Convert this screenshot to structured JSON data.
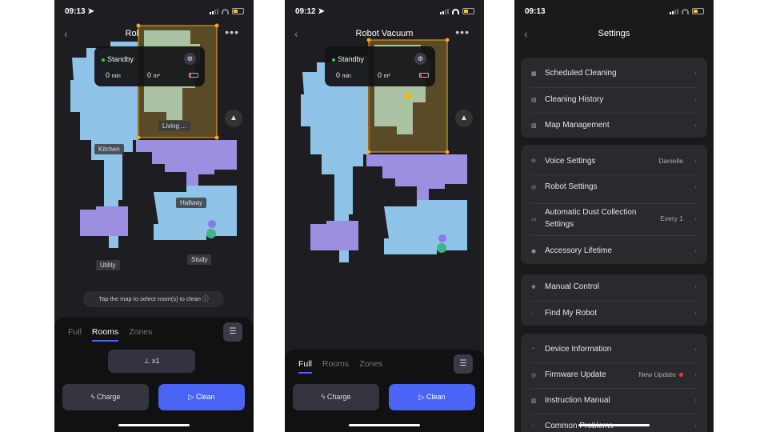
{
  "screens": [
    {
      "time": "09:13",
      "title": "Robot Vacuum",
      "status": "Standby",
      "duration": "0",
      "duration_unit": "min",
      "area": "0",
      "area_unit": "m²",
      "rooms": [
        "Living ...",
        "Kitchen",
        "Hallway",
        "Utility",
        "Study"
      ],
      "hint": "Tap the map to select room(s) to clean",
      "tabs": [
        "Full",
        "Rooms",
        "Zones"
      ],
      "active_tab": "Rooms",
      "mop_passes": "x1",
      "charge": "Charge",
      "clean": "Clean"
    },
    {
      "time": "09:12",
      "title": "Robot Vacuum",
      "status": "Standby",
      "duration": "0",
      "duration_unit": "min",
      "area": "0",
      "area_unit": "m²",
      "tabs": [
        "Full",
        "Rooms",
        "Zones"
      ],
      "active_tab": "Full",
      "charge": "Charge",
      "clean": "Clean"
    },
    {
      "time": "09:13",
      "title": "Settings",
      "groups": [
        [
          {
            "icon": "calendar-icon",
            "label": "Scheduled Cleaning"
          },
          {
            "icon": "history-icon",
            "label": "Cleaning History"
          },
          {
            "icon": "map-icon",
            "label": "Map Management"
          }
        ],
        [
          {
            "icon": "voice-icon",
            "label": "Voice Settings",
            "value": "Danielle"
          },
          {
            "icon": "robot-icon",
            "label": "Robot Settings"
          },
          {
            "icon": "dust-icon",
            "label": "Automatic Dust Collection Settings",
            "value": "Every 1"
          },
          {
            "icon": "accessory-icon",
            "label": "Accessory Lifetime"
          }
        ],
        [
          {
            "icon": "joystick-icon",
            "label": "Manual Control"
          },
          {
            "icon": "find-icon",
            "label": "Find My Robot"
          }
        ],
        [
          {
            "icon": "device-icon",
            "label": "Device Information"
          },
          {
            "icon": "firmware-icon",
            "label": "Firmware Update",
            "value": "New Update"
          },
          {
            "icon": "manual-icon",
            "label": "Instruction Manual"
          },
          {
            "icon": "help-icon",
            "label": "Common Problems"
          }
        ]
      ]
    }
  ],
  "colors": {
    "accent": "#4a64f4",
    "room_blue": "#8fc3e8",
    "room_purple": "#9a8fe0",
    "selected_zone": "#f5a623",
    "update_dot": "#ff3333"
  }
}
